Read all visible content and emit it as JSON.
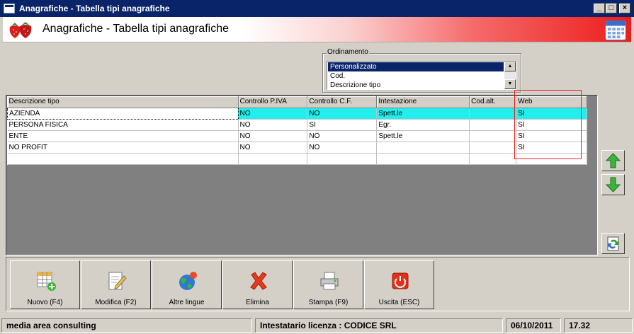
{
  "window": {
    "title": "Anagrafiche - Tabella tipi anagrafiche",
    "min_label": "_",
    "max_label": "□",
    "close_label": "×"
  },
  "header": {
    "title": "Anagrafiche - Tabella tipi anagrafiche"
  },
  "sorting": {
    "legend": "Ordinamento",
    "options": [
      "Personalizzato",
      "Cod.",
      "Descrizione tipo"
    ],
    "selected": "Personalizzato"
  },
  "table": {
    "columns": [
      "Descrizione tipo",
      "Controllo P.IVA",
      "Controllo C.F.",
      "Intestazione",
      "Cod.alt.",
      "Web"
    ],
    "rows": [
      [
        "AZIENDA",
        "NO",
        "NO",
        "Spett.le",
        "",
        "SI"
      ],
      [
        "PERSONA FISICA",
        "NO",
        "SI",
        "Egr.",
        "",
        "SI"
      ],
      [
        "ENTE",
        "NO",
        "NO",
        "Spett.le",
        "",
        "SI"
      ],
      [
        "NO PROFIT",
        "NO",
        "NO",
        "",
        "",
        "SI"
      ],
      [
        "",
        "",
        "",
        "",
        "",
        ""
      ]
    ],
    "selected_row": 0
  },
  "toolbar": {
    "new_label": "Nuovo (F4)",
    "edit_label": "Modifica (F2)",
    "languages_label": "Altre lingue",
    "delete_label": "Elimina",
    "print_label": "Stampa (F9)",
    "exit_label": "Uscita (ESC)"
  },
  "status": {
    "company": "media area consulting",
    "license": "Intestatario licenza : CODICE SRL",
    "date": "06/10/2011",
    "time": "17.32"
  },
  "colors": {
    "title_bar": "#0a246a",
    "selected_row": "#22eeee",
    "highlight_frame": "#e02020",
    "header_gradient_end": "#ee1c1c"
  }
}
